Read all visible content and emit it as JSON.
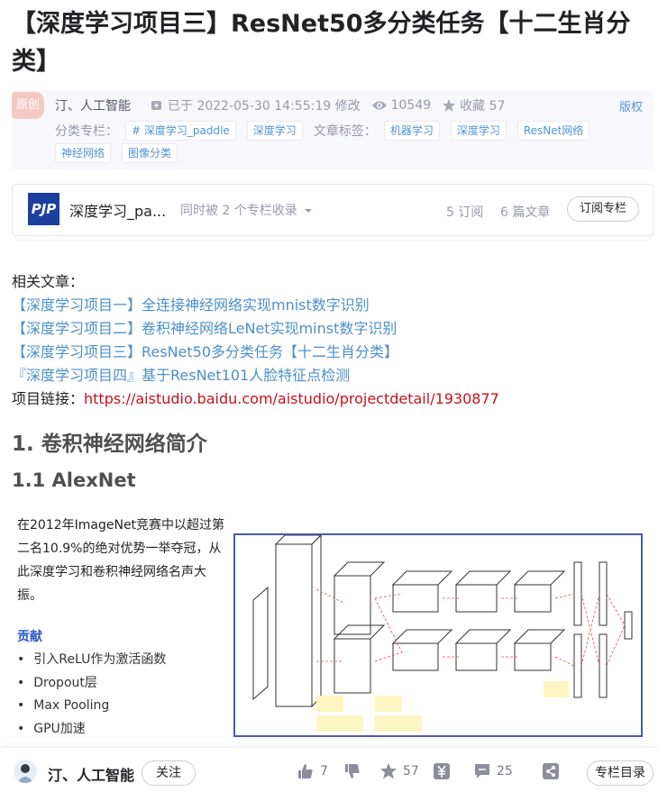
{
  "article": {
    "title": "【深度学习项目三】ResNet50多分类任务【十二生肖分类】",
    "badge": "原创",
    "author": "汀、人工智能",
    "modified": "已于 2022-05-30 14:55:19 修改",
    "views": "10549",
    "favorites_label": "收藏 57",
    "copyright": "版权",
    "column_label": "分类专栏：",
    "columns": [
      "# 深度学习_paddle",
      "深度学习"
    ],
    "tags_label": "文章标签：",
    "tags": [
      "机器学习",
      "深度学习",
      "ResNet网络",
      "神经网络",
      "图像分类"
    ]
  },
  "column_card": {
    "logo_text": "PJP",
    "name": "深度学习_pa...",
    "also_collected": "同时被 2 个专栏收录",
    "subscribers": "5 订阅",
    "articles": "6 篇文章",
    "subscribe_button": "订阅专栏"
  },
  "content": {
    "related_label": "相关文章：",
    "related_links": [
      "【深度学习项目一】全连接神经网络实现mnist数字识别",
      "【深度学习项目二】卷积神经网络LeNet实现minst数字识别",
      "【深度学习项目三】ResNet50多分类任务【十二生肖分类】",
      "『深度学习项目四』基于ResNet101人脸特征点检测"
    ],
    "project_label": "项目链接：",
    "project_url": "https://aistudio.baidu.com/aistudio/projectdetail/1930877",
    "h2": "1. 卷积神经网络简介",
    "h3": "1.1 AlexNet"
  },
  "figure": {
    "text": "在2012年ImageNet竞赛中以超过第二名10.9%的绝对优势一举夺冠，从此深度学习和卷积神经网络名声大振。",
    "contrib_title": "贡献",
    "contrib_items": [
      "引入ReLU作为激活函数",
      "Dropout层",
      "Max Pooling",
      "GPU加速"
    ]
  },
  "bottombar": {
    "author": "汀、人工智能",
    "follow": "关注",
    "likes": "7",
    "favorites": "57",
    "comments": "25",
    "toc": "专栏目录"
  },
  "colors": {
    "link": "#4c8fcb",
    "project_url": "#c8111a",
    "tag": "#5094d5"
  }
}
